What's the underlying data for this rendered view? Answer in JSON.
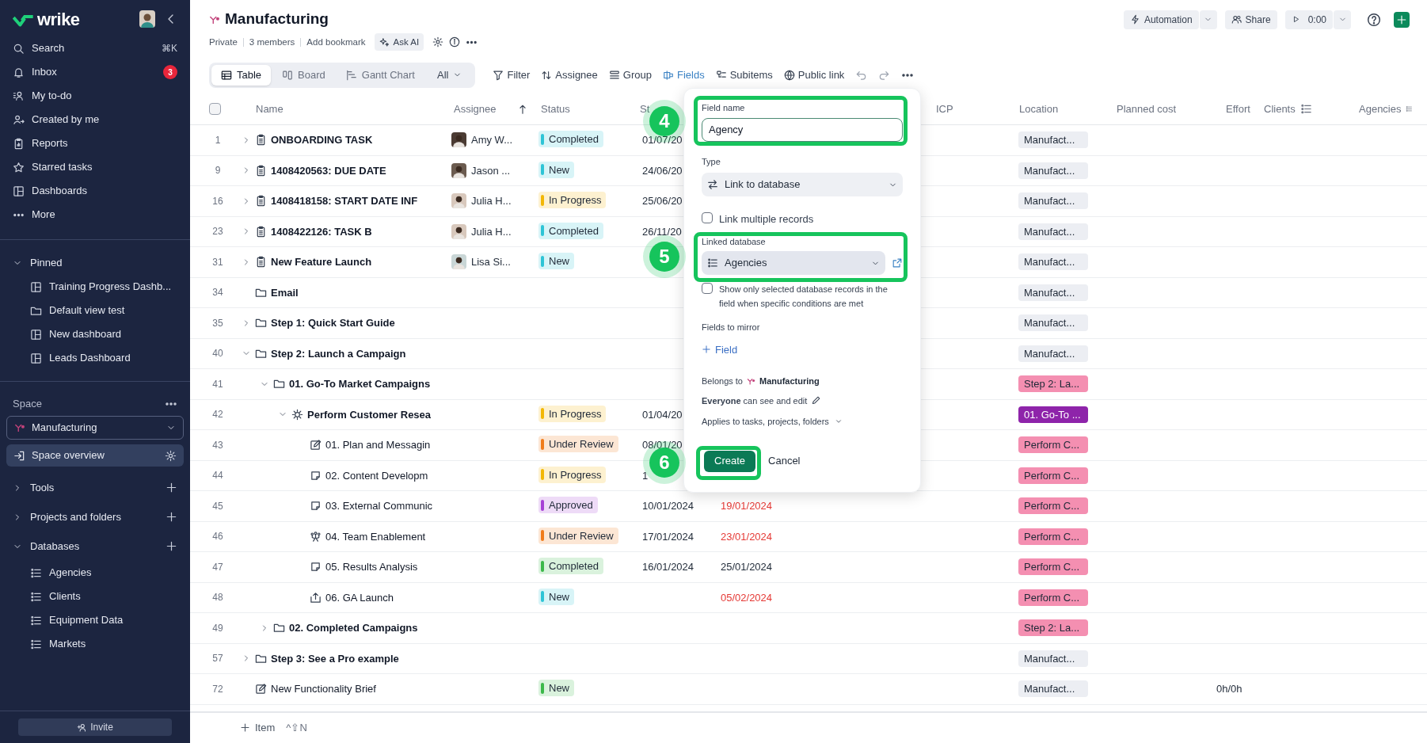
{
  "sidebar": {
    "logo": "wrike",
    "nav": [
      {
        "label": "Search",
        "shortcut": "⌘K"
      },
      {
        "label": "Inbox",
        "badge": "3"
      },
      {
        "label": "My to-do"
      },
      {
        "label": "Created by me"
      },
      {
        "label": "Reports"
      },
      {
        "label": "Starred tasks"
      },
      {
        "label": "Dashboards"
      },
      {
        "label": "More"
      }
    ],
    "pinned": {
      "label": "Pinned",
      "expanded": true,
      "items": [
        {
          "label": "Training Progress Dashb...",
          "kind": "dashboard"
        },
        {
          "label": "Default view test",
          "kind": "folder"
        },
        {
          "label": "New dashboard",
          "kind": "dashboard"
        },
        {
          "label": "Leads Dashboard",
          "kind": "dashboard"
        }
      ]
    },
    "space": {
      "label": "Space",
      "selector": "Manufacturing",
      "overview": {
        "label": "Space overview",
        "selected": true
      },
      "groups": [
        {
          "label": "Tools",
          "expanded": false
        },
        {
          "label": "Projects and folders",
          "expanded": false
        },
        {
          "label": "Databases",
          "expanded": true,
          "children": [
            "Agencies",
            "Clients",
            "Equipment Data",
            "Markets"
          ]
        }
      ]
    },
    "invite": "Invite"
  },
  "header": {
    "title": "Manufacturing",
    "meta": [
      "Private",
      "3 members",
      "Add bookmark"
    ],
    "ask_ai": "Ask AI",
    "automation": "Automation",
    "share": "Share",
    "timer": "0:00"
  },
  "views": [
    {
      "label": "Table",
      "selected": true
    },
    {
      "label": "Board",
      "selected": false
    },
    {
      "label": "Gantt Chart",
      "selected": false
    }
  ],
  "view_filter": "All",
  "toolbar": [
    {
      "label": "Filter",
      "active": false
    },
    {
      "label": "Assignee",
      "active": false
    },
    {
      "label": "Group",
      "active": false
    },
    {
      "label": "Fields",
      "active": true
    },
    {
      "label": "Subitems",
      "active": false
    },
    {
      "label": "Public link",
      "active": false
    }
  ],
  "table": {
    "select_all": {
      "checked": false
    },
    "columns": [
      {
        "label": "Name"
      },
      {
        "label": "Assignee",
        "sorted": true
      },
      {
        "label": "Status"
      },
      {
        "label": "St"
      },
      {
        "label": "ICP"
      },
      {
        "label": "Location"
      },
      {
        "label": "Planned cost"
      },
      {
        "label": "Effort"
      },
      {
        "label": "Clients",
        "kind": "linked"
      },
      {
        "label": "Agencies",
        "kind": "linked"
      }
    ],
    "rows": [
      {
        "num": "1",
        "expanded": false,
        "kind": "task",
        "name": "ONBOARDING TASK",
        "assignee": "Amy W...",
        "status": {
          "label": "Completed",
          "color": "#2ec4d6"
        },
        "start": "01/07/20",
        "location": {
          "label": "Manufact...",
          "color": "#eceef3"
        }
      },
      {
        "num": "9",
        "expanded": false,
        "kind": "task",
        "name": "1408420563: DUE DATE",
        "assignee": "Jason ...",
        "status": {
          "label": "New",
          "color": "#2ec4d6"
        },
        "start": "24/06/20",
        "location": {
          "label": "Manufact...",
          "color": "#eceef3"
        }
      },
      {
        "num": "16",
        "expanded": false,
        "kind": "task",
        "name": "1408418158: START DATE INF",
        "assignee": "Julia H...",
        "status": {
          "label": "In Progress",
          "color": "#f2b705"
        },
        "start": "25/06/20",
        "location": {
          "label": "Manufact...",
          "color": "#eceef3"
        }
      },
      {
        "num": "23",
        "expanded": false,
        "kind": "task",
        "name": "1408422126: TASK B",
        "assignee": "Julia H...",
        "status": {
          "label": "Completed",
          "color": "#2ec4d6"
        },
        "start": "26/11/20",
        "location": {
          "label": "Manufact...",
          "color": "#eceef3"
        }
      },
      {
        "num": "31",
        "expanded": false,
        "kind": "task",
        "name": "New Feature Launch",
        "assignee": "Lisa Si...",
        "status": {
          "label": "New",
          "color": "#2ec4d6"
        },
        "location": {
          "label": "Manufact...",
          "color": "#eceef3"
        }
      },
      {
        "num": "34",
        "kind": "folder",
        "name": "Email",
        "location": {
          "label": "Manufact...",
          "color": "#eceef3"
        }
      },
      {
        "num": "35",
        "expanded": false,
        "kind": "folder",
        "name": "Step 1: Quick Start Guide",
        "location": {
          "label": "Manufact...",
          "color": "#eceef3"
        }
      },
      {
        "num": "40",
        "expanded": true,
        "kind": "folder",
        "name": "Step 2: Launch a Campaign",
        "location": {
          "label": "Manufact...",
          "color": "#eceef3"
        },
        "children": [
          {
            "num": "41",
            "expanded": true,
            "kind": "folder",
            "name": "01. Go-To Market Campaigns",
            "location": {
              "label": "Step 2: La...",
              "color": "#f48fb1"
            },
            "children": [
              {
                "num": "42",
                "expanded": true,
                "kind": "project",
                "name": "Perform Customer Resea",
                "status": {
                  "label": "In Progress",
                  "color": "#f2b705"
                },
                "start": "01/04/20",
                "location": {
                  "label": "01. Go-To ...",
                  "color": "#8e24aa"
                },
                "children": [
                  {
                    "num": "43",
                    "kind": "edit",
                    "name": "01. Plan and Messagin",
                    "status": {
                      "label": "Under Review",
                      "color": "#f07c1a"
                    },
                    "start": "08/01/20",
                    "location": {
                      "label": "Perform C...",
                      "color": "#f48fb1"
                    }
                  },
                  {
                    "num": "44",
                    "kind": "note",
                    "name": "02. Content Developm",
                    "status": {
                      "label": "In Progress",
                      "color": "#f2b705"
                    },
                    "start": "1",
                    "location": {
                      "label": "Perform C...",
                      "color": "#f48fb1"
                    }
                  },
                  {
                    "num": "45",
                    "kind": "note",
                    "name": "03. External Communic",
                    "status": {
                      "label": "Approved",
                      "color": "#a63fd6"
                    },
                    "start": "10/01/2024",
                    "due": "19/01/2024",
                    "overdue": true,
                    "location": {
                      "label": "Perform C...",
                      "color": "#f48fb1"
                    }
                  },
                  {
                    "num": "46",
                    "kind": "team",
                    "name": "04. Team Enablement",
                    "status": {
                      "label": "Under Review",
                      "color": "#f07c1a"
                    },
                    "start": "17/01/2024",
                    "due": "23/01/2024",
                    "overdue": true,
                    "location": {
                      "label": "Perform C...",
                      "color": "#f48fb1"
                    }
                  },
                  {
                    "num": "47",
                    "kind": "note",
                    "name": "05. Results Analysis",
                    "status": {
                      "label": "Completed",
                      "color": "#3cb84a"
                    },
                    "start": "16/01/2024",
                    "due": "25/01/2024",
                    "overdue": false,
                    "location": {
                      "label": "Perform C...",
                      "color": "#f48fb1"
                    }
                  },
                  {
                    "num": "48",
                    "kind": "launch",
                    "name": "06. GA Launch",
                    "status": {
                      "label": "New",
                      "color": "#2ec4d6"
                    },
                    "due": "05/02/2024",
                    "overdue": true,
                    "location": {
                      "label": "Perform C...",
                      "color": "#f48fb1"
                    }
                  }
                ]
              }
            ]
          },
          {
            "num": "49",
            "expanded": false,
            "kind": "folder",
            "name": "02. Completed Campaigns",
            "location": {
              "label": "Step 2: La...",
              "color": "#f48fb1"
            }
          }
        ]
      },
      {
        "num": "57",
        "expanded": false,
        "kind": "folder",
        "name": "Step 3: See a Pro example",
        "location": {
          "label": "Manufact...",
          "color": "#eceef3"
        }
      },
      {
        "num": "72",
        "kind": "edit",
        "name": "New Functionality Brief",
        "status": {
          "label": "New",
          "color": "#3cb84a"
        },
        "location": {
          "label": "Manufact...",
          "color": "#eceef3"
        },
        "effort": "0h/0h"
      }
    ],
    "add_item": "Item",
    "add_shortcut": "^⇧N"
  },
  "field_popup": {
    "field_name": {
      "label": "Field name",
      "value": "Agency"
    },
    "type": {
      "label": "Type",
      "value": "Link to database"
    },
    "link_multiple": {
      "label": "Link multiple records",
      "checked": false
    },
    "linked_database": {
      "label": "Linked database",
      "value": "Agencies"
    },
    "show_only": {
      "label": "Show only selected database records in the field when specific conditions are met",
      "checked": false
    },
    "fields_to_mirror": {
      "label": "Fields to mirror",
      "add": "Field"
    },
    "belongs_to": {
      "label": "Belongs to",
      "space": "Manufacturing"
    },
    "permissions": "**Everyone** can see and edit",
    "applies_to": "Applies to tasks, projects, folders",
    "create": "Create",
    "cancel": "Cancel"
  },
  "annotations": [
    "4",
    "5",
    "6"
  ]
}
